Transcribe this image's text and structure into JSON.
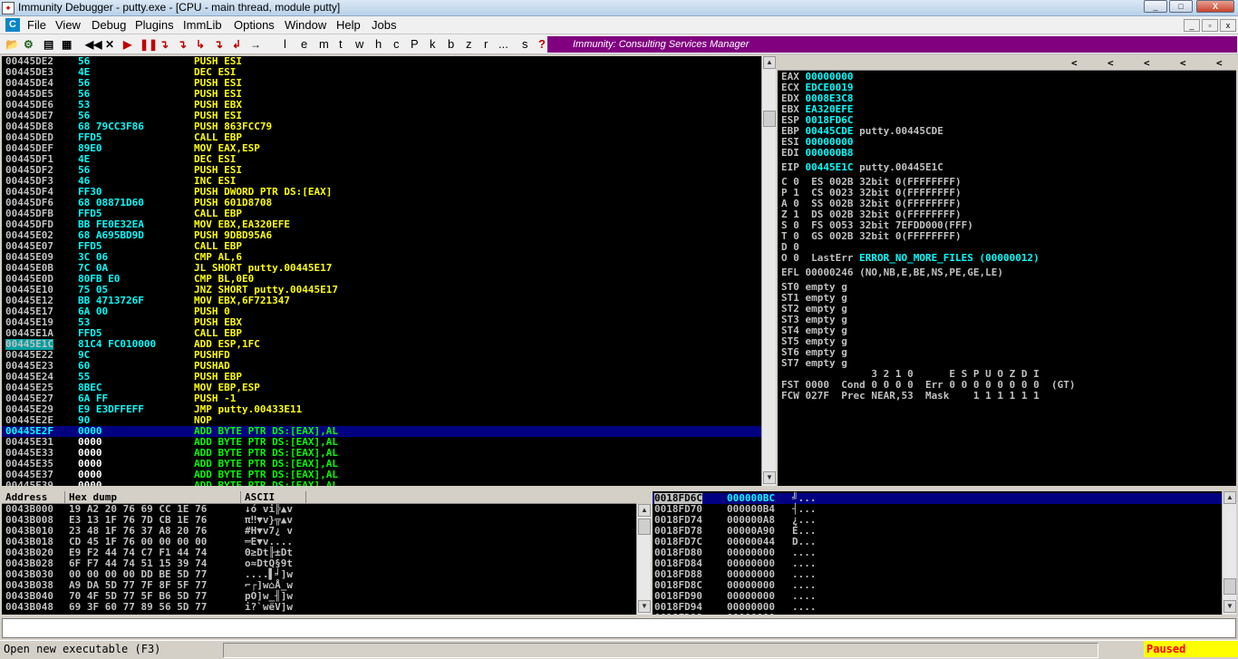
{
  "window": {
    "title": "Immunity Debugger - putty.exe - [CPU - main thread, module putty]",
    "controls": [
      "_",
      "□",
      "X"
    ]
  },
  "menubar": {
    "app_icon": "C",
    "items": [
      "File",
      "View",
      "Debug",
      "Plugins",
      "ImmLib",
      "Options",
      "Window",
      "Help",
      "Jobs"
    ],
    "mdi_controls": [
      "_",
      "▫",
      "x"
    ]
  },
  "toolbar": {
    "icons": [
      "open-folder-icon",
      "attach-icon",
      "list-icon",
      "window-icon",
      "rewind-icon",
      "close-icon",
      "run-icon",
      "pause-icon",
      "step-into-icon",
      "step-over-icon",
      "trace-into-icon",
      "trace-over-icon",
      "execute-till-return-icon",
      "go-to-icon"
    ],
    "icon_glyphs": [
      "📂",
      "⚙",
      "▤",
      "▦",
      "◀◀",
      "✕",
      "▶",
      "❚❚",
      "↴",
      "↴",
      "↳",
      "↴",
      "↲",
      "→"
    ],
    "letters": [
      "l",
      "e",
      "m",
      "t",
      "w",
      "h",
      "c",
      "P",
      "k",
      "b",
      "z",
      "r",
      "...",
      "s",
      "?"
    ],
    "banner": "Immunity: Consulting Services Manager"
  },
  "disasm": {
    "rows": [
      {
        "addr": "00445DE2",
        "hex": "56",
        "dis": "PUSH ESI"
      },
      {
        "addr": "00445DE3",
        "hex": "4E",
        "dis": "DEC ESI"
      },
      {
        "addr": "00445DE4",
        "hex": "56",
        "dis": "PUSH ESI"
      },
      {
        "addr": "00445DE5",
        "hex": "56",
        "dis": "PUSH ESI"
      },
      {
        "addr": "00445DE6",
        "hex": "53",
        "dis": "PUSH EBX"
      },
      {
        "addr": "00445DE7",
        "hex": "56",
        "dis": "PUSH ESI"
      },
      {
        "addr": "00445DE8",
        "hex": "68 79CC3F86",
        "dis": "PUSH 863FCC79"
      },
      {
        "addr": "00445DED",
        "hex": "FFD5",
        "dis": "CALL EBP"
      },
      {
        "addr": "00445DEF",
        "hex": "89E0",
        "dis": "MOV EAX,ESP"
      },
      {
        "addr": "00445DF1",
        "hex": "4E",
        "dis": "DEC ESI"
      },
      {
        "addr": "00445DF2",
        "hex": "56",
        "dis": "PUSH ESI"
      },
      {
        "addr": "00445DF3",
        "hex": "46",
        "dis": "INC ESI"
      },
      {
        "addr": "00445DF4",
        "hex": "FF30",
        "dis": "PUSH DWORD PTR DS:[EAX]"
      },
      {
        "addr": "00445DF6",
        "hex": "68 08871D60",
        "dis": "PUSH 601D8708"
      },
      {
        "addr": "00445DFB",
        "hex": "FFD5",
        "dis": "CALL EBP"
      },
      {
        "addr": "00445DFD",
        "hex": "BB FE0E32EA",
        "dis": "MOV EBX,EA320EFE"
      },
      {
        "addr": "00445E02",
        "hex": "68 A695BD9D",
        "dis": "PUSH 9DBD95A6"
      },
      {
        "addr": "00445E07",
        "hex": "FFD5",
        "dis": "CALL EBP"
      },
      {
        "addr": "00445E09",
        "hex": "3C 06",
        "dis": "CMP AL,6"
      },
      {
        "addr": "00445E0B",
        "hex": "7C 0A",
        "dis": "JL SHORT putty.00445E17"
      },
      {
        "addr": "00445E0D",
        "hex": "80FB E0",
        "dis": "CMP BL,0E0"
      },
      {
        "addr": "00445E10",
        "hex": "75 05",
        "dis": "JNZ SHORT putty.00445E17"
      },
      {
        "addr": "00445E12",
        "hex": "BB 4713726F",
        "dis": "MOV EBX,6F721347"
      },
      {
        "addr": "00445E17",
        "hex": "6A 00",
        "dis": "PUSH 0"
      },
      {
        "addr": "00445E19",
        "hex": "53",
        "dis": "PUSH EBX"
      },
      {
        "addr": "00445E1A",
        "hex": "FFD5",
        "dis": "CALL EBP"
      },
      {
        "addr": "00445E1C",
        "hex": "81C4 FC010000",
        "dis": "ADD ESP,1FC"
      },
      {
        "addr": "00445E22",
        "hex": "9C",
        "dis": "PUSHFD"
      },
      {
        "addr": "00445E23",
        "hex": "60",
        "dis": "PUSHAD"
      },
      {
        "addr": "00445E24",
        "hex": "55",
        "dis": "PUSH EBP"
      },
      {
        "addr": "00445E25",
        "hex": "8BEC",
        "dis": "MOV EBP,ESP"
      },
      {
        "addr": "00445E27",
        "hex": "6A FF",
        "dis": "PUSH -1"
      },
      {
        "addr": "00445E29",
        "hex": "E9 E3DFFEFF",
        "dis": "JMP putty.00433E11"
      },
      {
        "addr": "00445E2E",
        "hex": "90",
        "dis": "NOP"
      },
      {
        "addr": "00445E2F",
        "hex": "0000",
        "dis": "ADD BYTE PTR DS:[EAX],AL"
      },
      {
        "addr": "00445E31",
        "hex": "0000",
        "dis": "ADD BYTE PTR DS:[EAX],AL"
      },
      {
        "addr": "00445E33",
        "hex": "0000",
        "dis": "ADD BYTE PTR DS:[EAX],AL"
      },
      {
        "addr": "00445E35",
        "hex": "0000",
        "dis": "ADD BYTE PTR DS:[EAX],AL"
      },
      {
        "addr": "00445E37",
        "hex": "0000",
        "dis": "ADD BYTE PTR DS:[EAX],AL"
      },
      {
        "addr": "00445E39",
        "hex": "0000",
        "dis": "ADD BYTE PTR DS:[EAX],AL"
      }
    ],
    "current_index": 26,
    "selected_index": 34
  },
  "registers": {
    "header": "Registers (FPU)",
    "arrows": [
      "<",
      "<",
      "<",
      "<",
      "<"
    ],
    "lines": [
      {
        "name": "EAX",
        "value": "00000000",
        "note": ""
      },
      {
        "name": "ECX",
        "value": "EDCE0019",
        "note": ""
      },
      {
        "name": "EDX",
        "value": "0008E3C8",
        "note": ""
      },
      {
        "name": "EBX",
        "value": "EA320EFE",
        "note": ""
      },
      {
        "name": "ESP",
        "value": "0018FD6C",
        "note": ""
      },
      {
        "name": "EBP",
        "value": "00445CDE",
        "note": "putty.00445CDE"
      },
      {
        "name": "ESI",
        "value": "00000000",
        "note": ""
      },
      {
        "name": "EDI",
        "value": "000000B8",
        "note": ""
      }
    ],
    "eip": {
      "name": "EIP",
      "value": "00445E1C",
      "note": "putty.00445E1C"
    },
    "flags": [
      "C 0  ES 002B 32bit 0(FFFFFFFF)",
      "P 1  CS 0023 32bit 0(FFFFFFFF)",
      "A 0  SS 002B 32bit 0(FFFFFFFF)",
      "Z 1  DS 002B 32bit 0(FFFFFFFF)",
      "S 0  FS 0053 32bit 7EFDD000(FFF)",
      "T 0  GS 002B 32bit 0(FFFFFFFF)",
      "D 0"
    ],
    "lasterr_prefix": "O 0  LastErr ",
    "lasterr_value": "ERROR_NO_MORE_FILES (00000012)",
    "efl": "EFL 00000246 (NO,NB,E,BE,NS,PE,GE,LE)",
    "fpu": [
      "ST0 empty g",
      "ST1 empty g",
      "ST2 empty g",
      "ST3 empty g",
      "ST4 empty g",
      "ST5 empty g",
      "ST6 empty g",
      "ST7 empty g"
    ],
    "fst_header": "               3 2 1 0      E S P U O Z D I",
    "fst": "FST 0000  Cond 0 0 0 0  Err 0 0 0 0 0 0 0 0  (GT)",
    "fcw": "FCW 027F  Prec NEAR,53  Mask    1 1 1 1 1 1"
  },
  "dump": {
    "headers": [
      "Address",
      "Hex dump",
      "ASCII"
    ],
    "rows": [
      {
        "addr": "0043B000",
        "hex": "19 A2 20 76 69 CC 1E 76",
        "ascii": "↓ó vi╠▲v"
      },
      {
        "addr": "0043B008",
        "hex": "E3 13 1F 76 7D CB 1E 76",
        "ascii": "π‼▼v}╦▲v"
      },
      {
        "addr": "0043B010",
        "hex": "23 48 1F 76 37 A8 20 76",
        "ascii": "#H▼v7¿ v"
      },
      {
        "addr": "0043B018",
        "hex": "CD 45 1F 76 00 00 00 00",
        "ascii": "═E▼v...."
      },
      {
        "addr": "0043B020",
        "hex": "E9 F2 44 74 C7 F1 44 74",
        "ascii": "Θ≥Dt╟±Dt"
      },
      {
        "addr": "0043B028",
        "hex": "6F F7 44 74 51 15 39 74",
        "ascii": "o≈DtQ§9t"
      },
      {
        "addr": "0043B030",
        "hex": "00 00 00 00 DD BE 5D 77",
        "ascii": "....▌╛]w"
      },
      {
        "addr": "0043B038",
        "hex": "A9 DA 5D 77 7F 8F 5F 77",
        "ascii": "⌐┌]w⌂Å_w"
      },
      {
        "addr": "0043B040",
        "hex": "70 4F 5D 77 5F B6 5D 77",
        "ascii": "pO]w_╢]w"
      },
      {
        "addr": "0043B048",
        "hex": "69 3F 60 77 89 56 5D 77",
        "ascii": "i?`wëV]w"
      }
    ]
  },
  "stack": {
    "rows": [
      {
        "addr": "0018FD6C",
        "value": "000000BC",
        "ascii": "╝..."
      },
      {
        "addr": "0018FD70",
        "value": "000000B4",
        "ascii": "┤..."
      },
      {
        "addr": "0018FD74",
        "value": "000000A8",
        "ascii": "¿..."
      },
      {
        "addr": "0018FD78",
        "value": "00000A90",
        "ascii": "É..."
      },
      {
        "addr": "0018FD7C",
        "value": "00000044",
        "ascii": "D..."
      },
      {
        "addr": "0018FD80",
        "value": "00000000",
        "ascii": "...."
      },
      {
        "addr": "0018FD84",
        "value": "00000000",
        "ascii": "...."
      },
      {
        "addr": "0018FD88",
        "value": "00000000",
        "ascii": "...."
      },
      {
        "addr": "0018FD8C",
        "value": "00000000",
        "ascii": "...."
      },
      {
        "addr": "0018FD90",
        "value": "00000000",
        "ascii": "...."
      },
      {
        "addr": "0018FD94",
        "value": "00000000",
        "ascii": "...."
      },
      {
        "addr": "0018FD98",
        "value": "00000000",
        "ascii": "...."
      }
    ],
    "selected_index": 0
  },
  "command": {
    "value": ""
  },
  "status": {
    "text": "Open new executable (F3)",
    "state": "Paused"
  },
  "colors": {
    "background": "#000000",
    "address": "#c0c0c0",
    "hex": "#00ffff",
    "disasm": "#ffff00",
    "selection": "#000080",
    "banner": "#800080",
    "paused_bg": "#ffff00",
    "paused_fg": "#ff0000"
  }
}
